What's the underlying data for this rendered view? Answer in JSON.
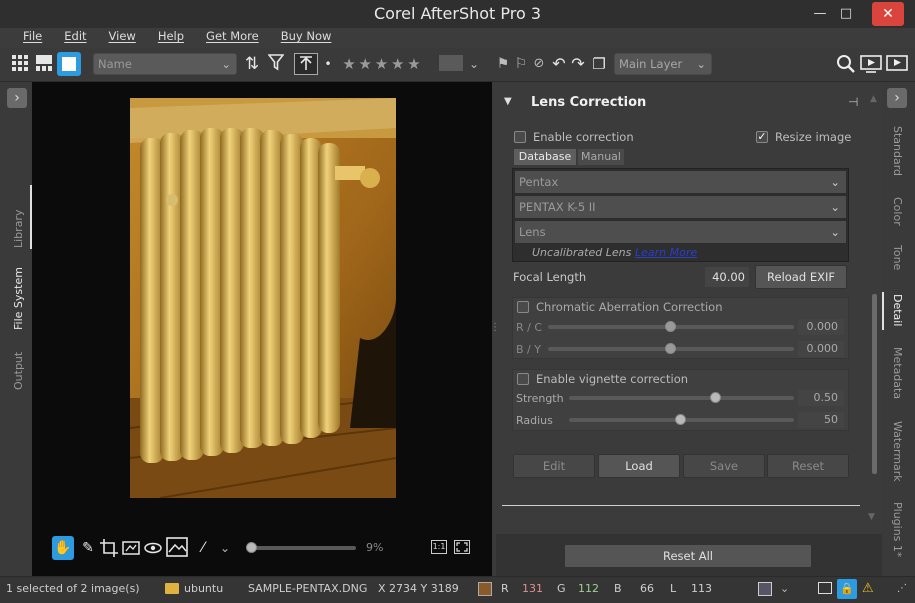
{
  "window": {
    "title": "Corel AfterShot Pro 3",
    "minimize": "—",
    "maximize": "□",
    "close": "✕"
  },
  "menu": [
    "File",
    "Edit",
    "View",
    "Help",
    "Get More",
    "Buy Now"
  ],
  "toolbar": {
    "sort_value": "Name",
    "layer_value": "Main Layer",
    "stars": "★ ★ ★ ★ ★"
  },
  "left_tabs": [
    "Library",
    "File System",
    "Output"
  ],
  "right_tabs": [
    "Standard",
    "Color",
    "Tone",
    "Detail",
    "Metadata",
    "Watermark",
    "Plugins 1*"
  ],
  "viewer": {
    "zoom": "9%",
    "one_to_one": "1:1"
  },
  "lens": {
    "title": "Lens Correction",
    "enable_label": "Enable correction",
    "enable_checked": false,
    "resize_label": "Resize image",
    "resize_checked": true,
    "tab_database": "Database",
    "tab_manual": "Manual",
    "make": "Pentax",
    "model": "PENTAX K-5 II",
    "lens": "Lens",
    "uncalibrated": "Uncalibrated Lens",
    "learn_more": "Learn More",
    "focal_label": "Focal Length",
    "focal_value": "40.00",
    "reload_exif": "Reload EXIF",
    "ca_label": "Chromatic Aberration Correction",
    "rc_label": "R / C",
    "rc_value": "0.000",
    "by_label": "B / Y",
    "by_value": "0.000",
    "vig_label": "Enable vignette correction",
    "strength_label": "Strength",
    "strength_value": "0.50",
    "radius_label": "Radius",
    "radius_value": "50",
    "edit": "Edit",
    "load": "Load",
    "save": "Save",
    "reset": "Reset",
    "reset_all": "Reset All"
  },
  "status": {
    "selected": "1 selected of 2 image(s)",
    "folder": "ubuntu",
    "file": "SAMPLE-PENTAX.DNG",
    "coords": "X 2734  Y 3189",
    "r_label": "R",
    "r_value": "131",
    "g_label": "G",
    "g_value": "112",
    "b_label": "B",
    "b_value": "66",
    "l_label": "L",
    "l_value": "113"
  }
}
